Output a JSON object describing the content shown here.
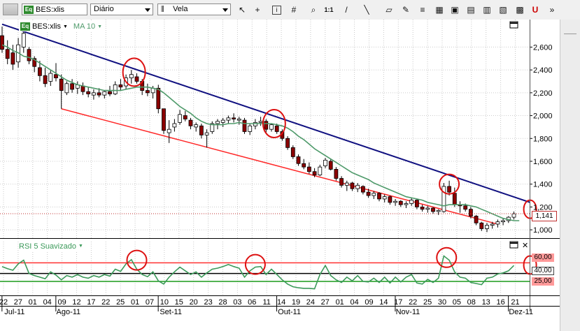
{
  "toolbar": {
    "symbol": "BES:xlis",
    "symbol_badge": "Eq",
    "period": "Diário",
    "chart_style": "Vela",
    "icons": [
      "cursor-icon",
      "crosshair-icon",
      "info-icon",
      "grid-icon",
      "zoom-icon",
      "scale-icon",
      "line-tool-icon",
      "eraser-icon",
      "pencil-icon",
      "fibonacci-icon",
      "indicator-icon",
      "alert-icon",
      "news-icon",
      "calendar-icon",
      "magnet-icon"
    ],
    "scale_label": "1:1"
  },
  "legend": {
    "symbol_badge": "Eq",
    "symbol": "BES:xlis",
    "indicator": "MA 10"
  },
  "colors": {
    "candle_up": "#ffffff",
    "candle_down": "#8b0000",
    "ma": "#4e9a6a",
    "resistance": "#101080",
    "support": "#ff2a2a",
    "rsi_line": "#3c9a5a",
    "circle": "#dd1111",
    "rsi_high": "#ff3030",
    "rsi_mid": "#000000",
    "rsi_low": "#1a9a1a"
  },
  "rsi_panel": {
    "title": "RSI 5 Suavizado",
    "levels": [
      "60,00",
      "40,00",
      "25,00"
    ]
  },
  "price_label": "1,141",
  "chart_data": {
    "type": "candlestick",
    "y_axis_ticks": [
      "2,600",
      "2,400",
      "2,200",
      "2,000",
      "1,800",
      "1,600",
      "1,400",
      "1,200",
      "1,000"
    ],
    "ylim": [
      0.97,
      2.78
    ],
    "x_ticks": [
      "22",
      "27",
      "01",
      "04",
      "09",
      "12",
      "17",
      "22",
      "25",
      "01",
      "07",
      "10",
      "15",
      "20",
      "23",
      "28",
      "03",
      "06",
      "11",
      "14",
      "19",
      "24",
      "27",
      "01",
      "04",
      "09",
      "14",
      "17",
      "22",
      "25",
      "30",
      "05",
      "08",
      "13",
      "16",
      "21"
    ],
    "x_months": [
      {
        "label": "Jul-11",
        "at": 0.5
      },
      {
        "label": "Ago-11",
        "at": 10.5
      },
      {
        "label": "Set-11",
        "at": 29.5
      },
      {
        "label": "Out-11",
        "at": 51.5
      },
      {
        "label": "Nov-11",
        "at": 73.5
      },
      {
        "label": "Dez-11",
        "at": 94.5
      }
    ],
    "candles": [
      {
        "o": 2.7,
        "h": 2.78,
        "l": 2.55,
        "c": 2.58
      },
      {
        "o": 2.58,
        "h": 2.66,
        "l": 2.45,
        "c": 2.5
      },
      {
        "o": 2.55,
        "h": 2.62,
        "l": 2.4,
        "c": 2.45
      },
      {
        "o": 2.47,
        "h": 2.68,
        "l": 2.42,
        "c": 2.62
      },
      {
        "o": 2.6,
        "h": 2.75,
        "l": 2.55,
        "c": 2.72
      },
      {
        "o": 2.58,
        "h": 2.6,
        "l": 2.45,
        "c": 2.48
      },
      {
        "o": 2.5,
        "h": 2.52,
        "l": 2.38,
        "c": 2.43
      },
      {
        "o": 2.42,
        "h": 2.48,
        "l": 2.3,
        "c": 2.35
      },
      {
        "o": 2.35,
        "h": 2.42,
        "l": 2.25,
        "c": 2.28
      },
      {
        "o": 2.3,
        "h": 2.4,
        "l": 2.26,
        "c": 2.37
      },
      {
        "o": 2.36,
        "h": 2.46,
        "l": 2.3,
        "c": 2.33
      },
      {
        "o": 2.32,
        "h": 2.36,
        "l": 2.06,
        "c": 2.22
      },
      {
        "o": 2.2,
        "h": 2.3,
        "l": 2.18,
        "c": 2.28
      },
      {
        "o": 2.28,
        "h": 2.32,
        "l": 2.2,
        "c": 2.23
      },
      {
        "o": 2.24,
        "h": 2.3,
        "l": 2.19,
        "c": 2.27
      },
      {
        "o": 2.26,
        "h": 2.29,
        "l": 2.18,
        "c": 2.21
      },
      {
        "o": 2.21,
        "h": 2.25,
        "l": 2.16,
        "c": 2.19
      },
      {
        "o": 2.18,
        "h": 2.23,
        "l": 2.14,
        "c": 2.2
      },
      {
        "o": 2.2,
        "h": 2.24,
        "l": 2.16,
        "c": 2.18
      },
      {
        "o": 2.18,
        "h": 2.22,
        "l": 2.15,
        "c": 2.21
      },
      {
        "o": 2.21,
        "h": 2.26,
        "l": 2.17,
        "c": 2.19
      },
      {
        "o": 2.19,
        "h": 2.3,
        "l": 2.18,
        "c": 2.27
      },
      {
        "o": 2.27,
        "h": 2.32,
        "l": 2.22,
        "c": 2.25
      },
      {
        "o": 2.26,
        "h": 2.36,
        "l": 2.23,
        "c": 2.33
      },
      {
        "o": 2.33,
        "h": 2.4,
        "l": 2.28,
        "c": 2.36
      },
      {
        "o": 2.34,
        "h": 2.37,
        "l": 2.28,
        "c": 2.3
      },
      {
        "o": 2.3,
        "h": 2.32,
        "l": 2.18,
        "c": 2.22
      },
      {
        "o": 2.22,
        "h": 2.28,
        "l": 2.17,
        "c": 2.2
      },
      {
        "o": 2.2,
        "h": 2.26,
        "l": 2.15,
        "c": 2.24
      },
      {
        "o": 2.24,
        "h": 2.27,
        "l": 2.02,
        "c": 2.06
      },
      {
        "o": 2.06,
        "h": 2.06,
        "l": 1.84,
        "c": 1.87
      },
      {
        "o": 1.85,
        "h": 1.96,
        "l": 1.76,
        "c": 1.88
      },
      {
        "o": 1.9,
        "h": 1.97,
        "l": 1.86,
        "c": 1.93
      },
      {
        "o": 1.94,
        "h": 2.05,
        "l": 1.92,
        "c": 2.01
      },
      {
        "o": 2.0,
        "h": 2.04,
        "l": 1.95,
        "c": 1.97
      },
      {
        "o": 1.96,
        "h": 1.98,
        "l": 1.88,
        "c": 1.91
      },
      {
        "o": 1.9,
        "h": 1.94,
        "l": 1.86,
        "c": 1.92
      },
      {
        "o": 1.91,
        "h": 1.93,
        "l": 1.8,
        "c": 1.83
      },
      {
        "o": 1.83,
        "h": 1.88,
        "l": 1.72,
        "c": 1.85
      },
      {
        "o": 1.86,
        "h": 1.95,
        "l": 1.84,
        "c": 1.93
      },
      {
        "o": 1.93,
        "h": 1.97,
        "l": 1.88,
        "c": 1.95
      },
      {
        "o": 1.94,
        "h": 1.98,
        "l": 1.9,
        "c": 1.96
      },
      {
        "o": 1.96,
        "h": 2.0,
        "l": 1.93,
        "c": 1.98
      },
      {
        "o": 1.98,
        "h": 2.02,
        "l": 1.94,
        "c": 1.97
      },
      {
        "o": 1.96,
        "h": 1.99,
        "l": 1.92,
        "c": 1.97
      },
      {
        "o": 1.96,
        "h": 1.98,
        "l": 1.84,
        "c": 1.86
      },
      {
        "o": 1.86,
        "h": 1.93,
        "l": 1.83,
        "c": 1.91
      },
      {
        "o": 1.91,
        "h": 1.97,
        "l": 1.88,
        "c": 1.94
      },
      {
        "o": 1.94,
        "h": 1.99,
        "l": 1.91,
        "c": 1.95
      },
      {
        "o": 1.95,
        "h": 1.97,
        "l": 1.85,
        "c": 1.88
      },
      {
        "o": 1.88,
        "h": 1.93,
        "l": 1.86,
        "c": 1.92
      },
      {
        "o": 1.91,
        "h": 1.93,
        "l": 1.84,
        "c": 1.86
      },
      {
        "o": 1.86,
        "h": 1.88,
        "l": 1.78,
        "c": 1.8
      },
      {
        "o": 1.8,
        "h": 1.82,
        "l": 1.7,
        "c": 1.72
      },
      {
        "o": 1.72,
        "h": 1.74,
        "l": 1.62,
        "c": 1.64
      },
      {
        "o": 1.64,
        "h": 1.66,
        "l": 1.56,
        "c": 1.58
      },
      {
        "o": 1.58,
        "h": 1.62,
        "l": 1.53,
        "c": 1.55
      },
      {
        "o": 1.55,
        "h": 1.59,
        "l": 1.49,
        "c": 1.51
      },
      {
        "o": 1.51,
        "h": 1.54,
        "l": 1.46,
        "c": 1.48
      },
      {
        "o": 1.48,
        "h": 1.57,
        "l": 1.47,
        "c": 1.55
      },
      {
        "o": 1.56,
        "h": 1.63,
        "l": 1.54,
        "c": 1.61
      },
      {
        "o": 1.6,
        "h": 1.62,
        "l": 1.52,
        "c": 1.53
      },
      {
        "o": 1.53,
        "h": 1.55,
        "l": 1.43,
        "c": 1.45
      },
      {
        "o": 1.45,
        "h": 1.47,
        "l": 1.37,
        "c": 1.39
      },
      {
        "o": 1.39,
        "h": 1.43,
        "l": 1.34,
        "c": 1.41
      },
      {
        "o": 1.41,
        "h": 1.42,
        "l": 1.34,
        "c": 1.36
      },
      {
        "o": 1.36,
        "h": 1.41,
        "l": 1.33,
        "c": 1.39
      },
      {
        "o": 1.38,
        "h": 1.39,
        "l": 1.31,
        "c": 1.33
      },
      {
        "o": 1.33,
        "h": 1.36,
        "l": 1.28,
        "c": 1.3
      },
      {
        "o": 1.3,
        "h": 1.34,
        "l": 1.27,
        "c": 1.32
      },
      {
        "o": 1.32,
        "h": 1.33,
        "l": 1.25,
        "c": 1.27
      },
      {
        "o": 1.27,
        "h": 1.31,
        "l": 1.24,
        "c": 1.29
      },
      {
        "o": 1.29,
        "h": 1.3,
        "l": 1.22,
        "c": 1.24
      },
      {
        "o": 1.24,
        "h": 1.27,
        "l": 1.21,
        "c": 1.25
      },
      {
        "o": 1.25,
        "h": 1.26,
        "l": 1.2,
        "c": 1.22
      },
      {
        "o": 1.22,
        "h": 1.25,
        "l": 1.19,
        "c": 1.23
      },
      {
        "o": 1.23,
        "h": 1.28,
        "l": 1.21,
        "c": 1.26
      },
      {
        "o": 1.26,
        "h": 1.27,
        "l": 1.18,
        "c": 1.2
      },
      {
        "o": 1.2,
        "h": 1.22,
        "l": 1.16,
        "c": 1.18
      },
      {
        "o": 1.18,
        "h": 1.21,
        "l": 1.15,
        "c": 1.19
      },
      {
        "o": 1.19,
        "h": 1.2,
        "l": 1.14,
        "c": 1.16
      },
      {
        "o": 1.16,
        "h": 1.18,
        "l": 1.13,
        "c": 1.17
      },
      {
        "o": 1.16,
        "h": 1.41,
        "l": 1.15,
        "c": 1.38
      },
      {
        "o": 1.38,
        "h": 1.43,
        "l": 1.3,
        "c": 1.33
      },
      {
        "o": 1.32,
        "h": 1.37,
        "l": 1.2,
        "c": 1.22
      },
      {
        "o": 1.22,
        "h": 1.25,
        "l": 1.15,
        "c": 1.21
      },
      {
        "o": 1.21,
        "h": 1.23,
        "l": 1.16,
        "c": 1.18
      },
      {
        "o": 1.18,
        "h": 1.2,
        "l": 1.1,
        "c": 1.12
      },
      {
        "o": 1.12,
        "h": 1.13,
        "l": 1.04,
        "c": 1.06
      },
      {
        "o": 1.06,
        "h": 1.07,
        "l": 0.99,
        "c": 1.01
      },
      {
        "o": 1.01,
        "h": 1.06,
        "l": 0.98,
        "c": 1.04
      },
      {
        "o": 1.04,
        "h": 1.07,
        "l": 1.01,
        "c": 1.05
      },
      {
        "o": 1.05,
        "h": 1.09,
        "l": 1.02,
        "c": 1.07
      },
      {
        "o": 1.07,
        "h": 1.1,
        "l": 1.04,
        "c": 1.08
      },
      {
        "o": 1.08,
        "h": 1.12,
        "l": 1.06,
        "c": 1.11
      },
      {
        "o": 1.11,
        "h": 1.16,
        "l": 1.09,
        "c": 1.14
      }
    ],
    "ma": [
      2.62,
      2.6,
      2.57,
      2.55,
      2.52,
      2.51,
      2.49,
      2.46,
      2.43,
      2.4,
      2.37,
      2.34,
      2.31,
      2.29,
      2.27,
      2.26,
      2.25,
      2.24,
      2.23,
      2.22,
      2.22,
      2.22,
      2.22,
      2.23,
      2.24,
      2.25,
      2.25,
      2.25,
      2.24,
      2.23,
      2.2,
      2.16,
      2.12,
      2.08,
      2.05,
      2.02,
      1.98,
      1.95,
      1.93,
      1.92,
      1.92,
      1.92,
      1.93,
      1.93,
      1.94,
      1.93,
      1.93,
      1.93,
      1.93,
      1.93,
      1.93,
      1.92,
      1.91,
      1.89,
      1.86,
      1.82,
      1.79,
      1.75,
      1.71,
      1.68,
      1.65,
      1.62,
      1.59,
      1.56,
      1.53,
      1.5,
      1.48,
      1.46,
      1.44,
      1.41,
      1.39,
      1.37,
      1.35,
      1.33,
      1.31,
      1.29,
      1.28,
      1.27,
      1.26,
      1.24,
      1.23,
      1.22,
      1.21,
      1.22,
      1.22,
      1.22,
      1.22,
      1.21,
      1.2,
      1.18,
      1.16,
      1.14,
      1.12,
      1.1,
      1.09,
      1.08,
      1.08
    ],
    "rsi": [
      53,
      49,
      46,
      58,
      65,
      40,
      36,
      33,
      30,
      43,
      37,
      28,
      36,
      33,
      38,
      33,
      31,
      36,
      33,
      38,
      35,
      48,
      44,
      58,
      66,
      48,
      38,
      34,
      43,
      26,
      20,
      33,
      43,
      52,
      45,
      38,
      43,
      33,
      41,
      48,
      50,
      53,
      57,
      53,
      50,
      33,
      45,
      52,
      53,
      38,
      48,
      38,
      28,
      20,
      15,
      13,
      12,
      12,
      11,
      38,
      55,
      36,
      28,
      23,
      33,
      26,
      36,
      25,
      24,
      31,
      23,
      33,
      22,
      33,
      24,
      33,
      38,
      22,
      20,
      29,
      23,
      31,
      73,
      65,
      43,
      33,
      31,
      23,
      21,
      19,
      31,
      33,
      39,
      41,
      45,
      55
    ],
    "resistance": {
      "from": {
        "index": 0,
        "value": 2.8
      },
      "to": {
        "index": 98,
        "value": 1.24
      }
    },
    "support": {
      "from": {
        "index": 11,
        "value": 2.06
      },
      "to": {
        "index": 92,
        "value": 1.05
      }
    },
    "circles": [
      {
        "panel": "price",
        "index": 24.5,
        "value": 2.38
      },
      {
        "panel": "price",
        "index": 50.5,
        "value": 1.93
      },
      {
        "panel": "price",
        "index": 83,
        "value": 1.4
      },
      {
        "panel": "price",
        "index": 98,
        "value": 1.18
      },
      {
        "panel": "rsi",
        "index": 25,
        "value": 65
      },
      {
        "panel": "rsi",
        "index": 47,
        "value": 57
      },
      {
        "panel": "rsi",
        "index": 82.5,
        "value": 70
      },
      {
        "panel": "rsi",
        "index": 98,
        "value": 56
      }
    ],
    "current_price": 1.141
  }
}
